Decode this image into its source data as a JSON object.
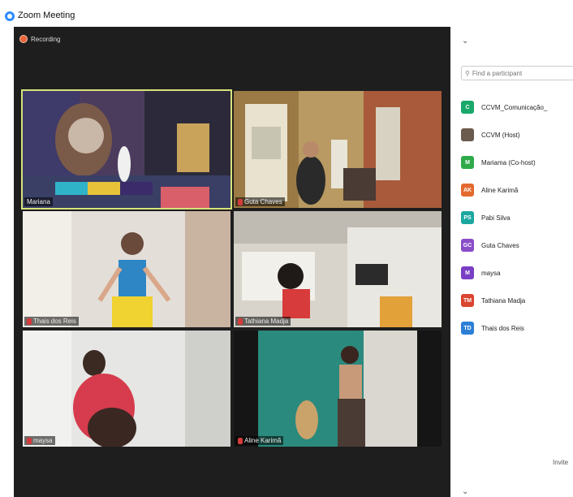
{
  "window": {
    "title": "Zoom Meeting"
  },
  "recording": {
    "label": "Recording"
  },
  "videos": [
    {
      "name": "Mariana",
      "active": true,
      "muted": false
    },
    {
      "name": "Guta Chaves",
      "active": false,
      "muted": true
    },
    {
      "name": "Thais dos Reis",
      "active": false,
      "muted": true
    },
    {
      "name": "Tathiana Madja",
      "active": false,
      "muted": true
    },
    {
      "name": "maysa",
      "active": false,
      "muted": true
    },
    {
      "name": "Aline Karimã",
      "active": false,
      "muted": true
    }
  ],
  "participants_panel": {
    "search_placeholder": "Find a participant",
    "invite_label": "Invite",
    "participants": [
      {
        "initials": "C",
        "name": "CCVM_Comunicação_",
        "color": "#1aa86b"
      },
      {
        "initials": "",
        "name": "CCVM (Host)",
        "color": "#6b5a4e"
      },
      {
        "initials": "M",
        "name": "Mariama (Co-host)",
        "color": "#2eaa4a"
      },
      {
        "initials": "AK",
        "name": "Aline Karimã",
        "color": "#e36a2e"
      },
      {
        "initials": "PS",
        "name": "Pabi Silva",
        "color": "#1ba7a0"
      },
      {
        "initials": "GC",
        "name": "Guta Chaves",
        "color": "#8a4ec9"
      },
      {
        "initials": "M",
        "name": "maysa",
        "color": "#7a3fc4"
      },
      {
        "initials": "TM",
        "name": "Tathiana Madja",
        "color": "#d9452f"
      },
      {
        "initials": "TD",
        "name": "Thais dos Reis",
        "color": "#2d7fd6"
      }
    ]
  }
}
